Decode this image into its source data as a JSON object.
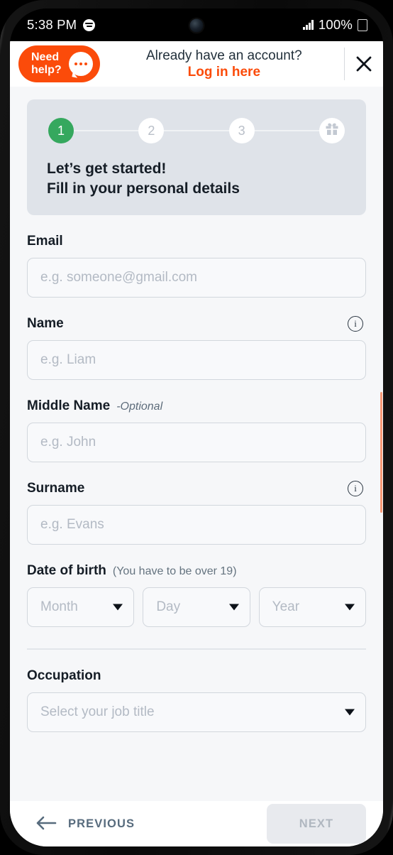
{
  "status_bar": {
    "time": "5:38 PM",
    "music_icon": "spotify-icon",
    "signal_icon": "signal-bars-icon",
    "battery_percent": "100%",
    "battery_icon": "battery-icon",
    "camera_icon": "front-camera-dot"
  },
  "header": {
    "need_help_label": "Need\nhelp?",
    "need_help_icon": "chat-bubble-icon",
    "account_question": "Already have an account?",
    "login_link": "Log in here",
    "close_icon": "close-icon"
  },
  "stepper": {
    "steps": [
      {
        "label": "1",
        "state": "active"
      },
      {
        "label": "2",
        "state": "idle"
      },
      {
        "label": "3",
        "state": "idle"
      },
      {
        "label": "",
        "state": "gift",
        "icon": "gift-icon"
      }
    ],
    "title": "Let’s get started!\nFill in your personal details"
  },
  "form": {
    "email": {
      "label": "Email",
      "placeholder": "e.g. someone@gmail.com",
      "value": ""
    },
    "name": {
      "label": "Name",
      "placeholder": "e.g. Liam",
      "value": "",
      "info_icon": "info-icon"
    },
    "middle_name": {
      "label": "Middle Name",
      "optional": "-Optional",
      "placeholder": "e.g. John",
      "value": ""
    },
    "surname": {
      "label": "Surname",
      "placeholder": "e.g. Evans",
      "value": "",
      "info_icon": "info-icon"
    },
    "date_of_birth": {
      "label": "Date of birth",
      "hint": "(You have to be over 19)",
      "month": {
        "placeholder": "Month",
        "value": ""
      },
      "day": {
        "placeholder": "Day",
        "value": ""
      },
      "year": {
        "placeholder": "Year",
        "value": ""
      }
    },
    "occupation": {
      "label": "Occupation",
      "placeholder": "Select your job title",
      "value": ""
    }
  },
  "bottom_nav": {
    "previous_label": "PREVIOUS",
    "previous_icon": "arrow-left-icon",
    "next_label": "NEXT"
  },
  "colors": {
    "brand_orange": "#fb4b0a",
    "step_active_green": "#35a85e",
    "page_background": "#f6f7f9",
    "stepper_card": "#dfe3e9",
    "text_dark": "#151d26"
  }
}
